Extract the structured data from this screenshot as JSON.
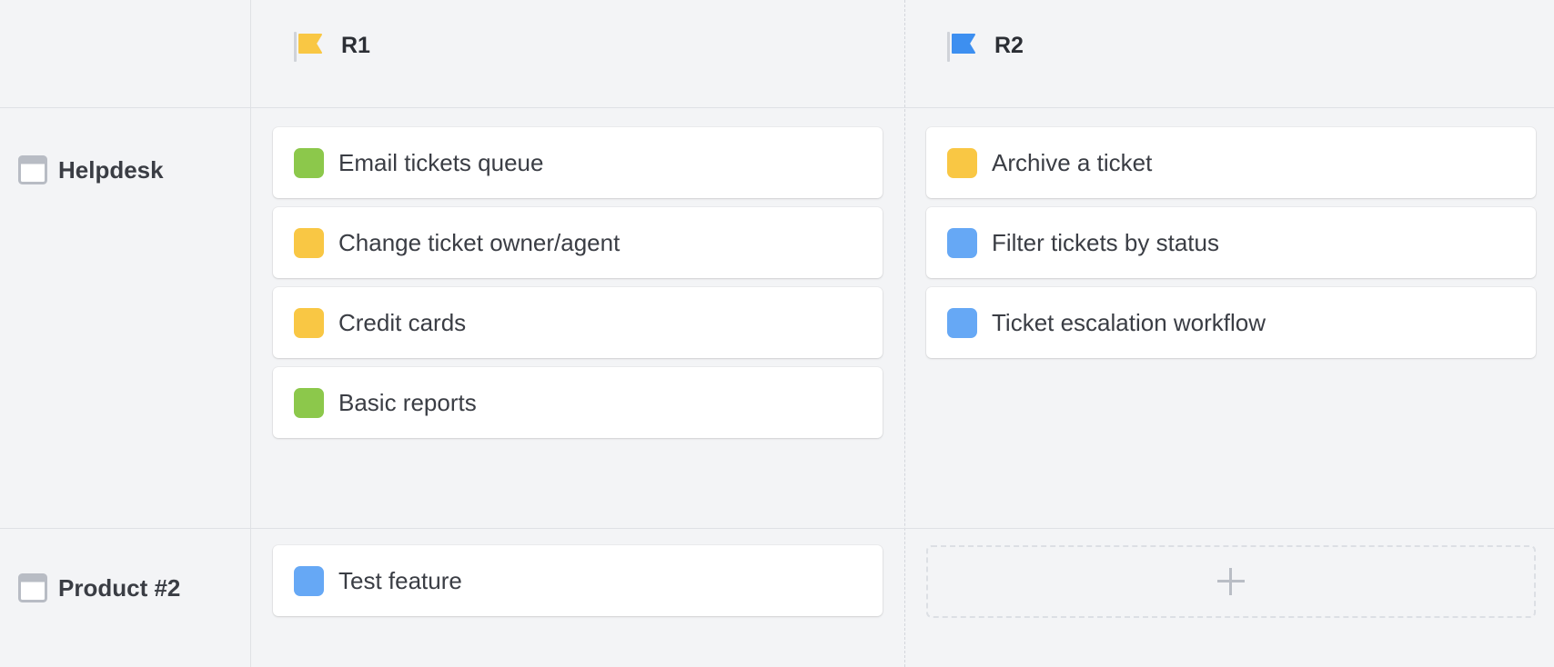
{
  "colors": {
    "green": "#8cc84b",
    "yellow": "#f9c744",
    "blue": "#66a8f5",
    "flag_r1": "#f9c744",
    "flag_r2": "#3d8ff0"
  },
  "releases": [
    {
      "title": "R1",
      "icon": "flag-icon"
    },
    {
      "title": "R2",
      "icon": "flag-icon"
    }
  ],
  "rows": [
    {
      "title": "Helpdesk",
      "icon": "window-icon",
      "cells": [
        [
          {
            "label": "Email tickets queue",
            "color": "green"
          },
          {
            "label": "Change ticket owner/agent",
            "color": "yellow"
          },
          {
            "label": "Credit cards",
            "color": "yellow"
          },
          {
            "label": "Basic reports",
            "color": "green"
          }
        ],
        [
          {
            "label": "Archive a ticket",
            "color": "yellow"
          },
          {
            "label": "Filter tickets by status",
            "color": "blue"
          },
          {
            "label": "Ticket escalation workflow",
            "color": "blue"
          }
        ]
      ]
    },
    {
      "title": "Product #2",
      "icon": "window-icon",
      "cells": [
        [
          {
            "label": "Test feature",
            "color": "blue"
          }
        ],
        []
      ]
    }
  ],
  "add_icon": "plus-icon"
}
